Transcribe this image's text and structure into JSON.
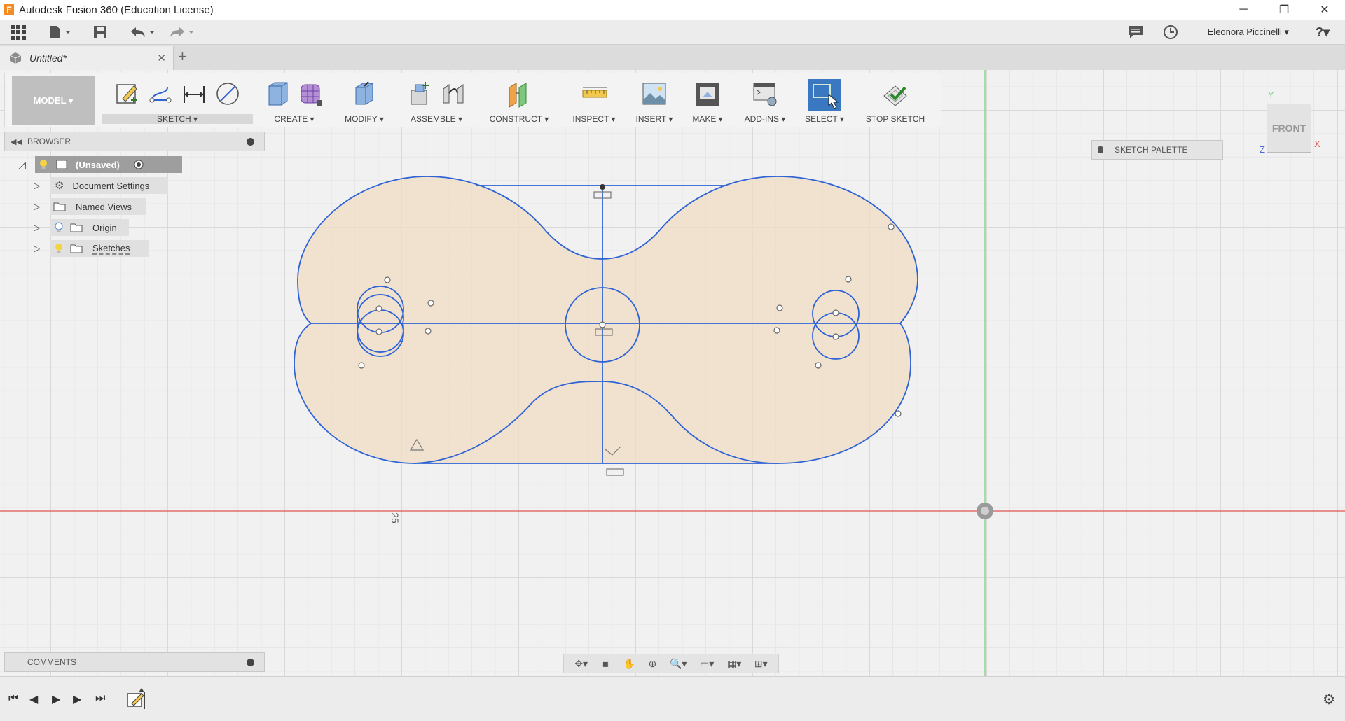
{
  "window": {
    "title": "Autodesk Fusion 360 (Education License)",
    "app_icon_letter": "F",
    "minimize": "─",
    "restore": "❐",
    "close": "✕"
  },
  "quickbar": {
    "user_name": "Eleonora Piccinelli ▾",
    "help": "?▾"
  },
  "tabs": [
    {
      "title": "Untitled*",
      "close": "✕"
    }
  ],
  "new_tab": "+",
  "toolbar": {
    "mode": "MODEL ▾",
    "groups": [
      {
        "label": "SKETCH ▾"
      },
      {
        "label": "CREATE ▾"
      },
      {
        "label": "MODIFY ▾"
      },
      {
        "label": "ASSEMBLE ▾"
      },
      {
        "label": "CONSTRUCT ▾"
      },
      {
        "label": "INSPECT ▾"
      },
      {
        "label": "INSERT ▾"
      },
      {
        "label": "MAKE ▾"
      },
      {
        "label": "ADD-INS ▾"
      },
      {
        "label": "SELECT ▾"
      },
      {
        "label": "STOP SKETCH"
      }
    ]
  },
  "browser": {
    "label": "BROWSER",
    "root": "(Unsaved)",
    "items": [
      {
        "label": "Document Settings"
      },
      {
        "label": "Named Views"
      },
      {
        "label": "Origin"
      },
      {
        "label": "Sketches"
      }
    ]
  },
  "sketch_palette": {
    "label": "SKETCH PALETTE"
  },
  "viewcube": {
    "face": "FRONT",
    "axis_y": "Y",
    "axis_x": "X",
    "axis_z": "Z"
  },
  "comments": {
    "label": "COMMENTS"
  },
  "dimension_label": "25",
  "colors": {
    "sketch_line": "#2e63d6",
    "sketch_fill": "#f0dcc4",
    "axis_red": "#e05555",
    "axis_green": "#7ed27e",
    "select_blue": "#3a78c2"
  }
}
